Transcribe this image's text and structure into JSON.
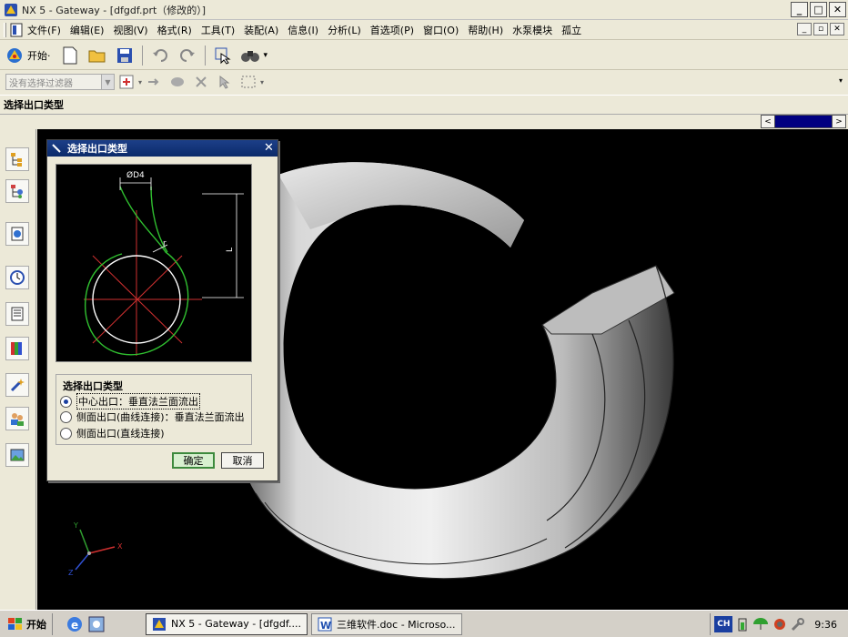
{
  "window": {
    "title": "NX 5 - Gateway - [dfgdf.prt（修改的）]",
    "buttons": [
      "_",
      "□",
      "✕"
    ]
  },
  "menu": {
    "items": [
      "文件(F)",
      "编辑(E)",
      "视图(V)",
      "格式(R)",
      "工具(T)",
      "装配(A)",
      "信息(I)",
      "分析(L)",
      "首选项(P)",
      "窗口(O)",
      "帮助(H)",
      "水泵模块",
      "孤立"
    ]
  },
  "toolbar": {
    "start_label": "开始·"
  },
  "filter": {
    "placeholder": "没有选择过滤器"
  },
  "cue": {
    "text": "选择出口类型"
  },
  "dialog": {
    "title": "选择出口类型",
    "preview": {
      "label_d4": "ØD4",
      "label_r": "r",
      "label_l": "L"
    },
    "group_title": "选择出口类型",
    "options": [
      "中心出口：垂直法兰面流出",
      "侧面出口(曲线连接)：垂直法兰面流出",
      "侧面出口(直线连接)"
    ],
    "selected_index": 0,
    "ok_label": "确定",
    "cancel_label": "取消"
  },
  "axes": {
    "x": "X",
    "y": "Y",
    "z": "Z"
  },
  "taskbar": {
    "start_label": "开始",
    "tasks": [
      "NX 5 - Gateway - [dfgdf....",
      "三维软件.doc - Microso..."
    ],
    "lang": "CH",
    "clock": "9:36"
  }
}
